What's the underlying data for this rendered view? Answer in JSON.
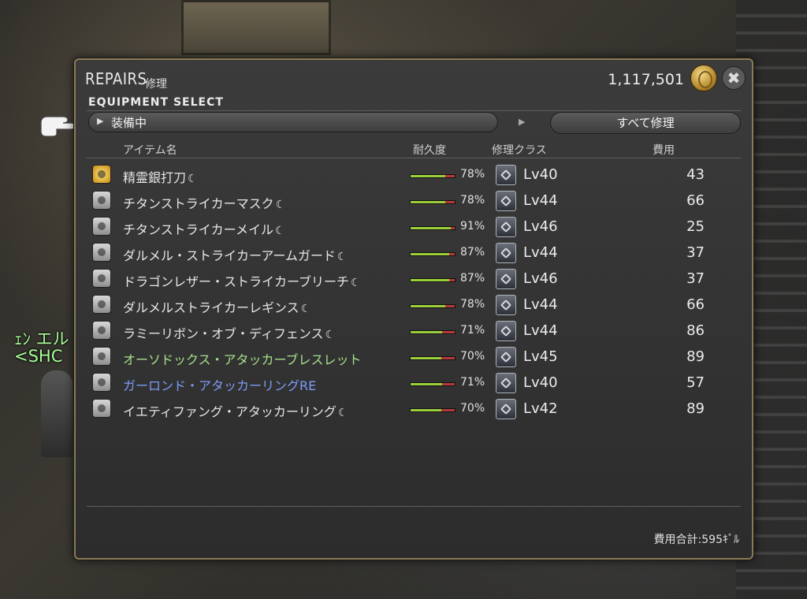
{
  "window": {
    "title": "REPAIRS",
    "title_jp": "修理",
    "gil": "1,117,501",
    "close_glyph": "✖",
    "section": "EQUIPMENT SELECT"
  },
  "controls": {
    "category_value": "装備中",
    "repair_all_label": "すべて修理"
  },
  "headers": {
    "item": "アイテム名",
    "durability": "耐久度",
    "repair_class": "修理クラス",
    "cost": "費用"
  },
  "items": [
    {
      "name": "精霊銀打刀",
      "hq": true,
      "durability": 78,
      "durability_text": "78%",
      "level": "Lv40",
      "cost": "43",
      "color": "white",
      "icon": "sword-icon",
      "icon_style": "gold",
      "class_icon": "blacksmith-icon"
    },
    {
      "name": "チタンストライカーマスク",
      "hq": true,
      "durability": 78,
      "durability_text": "78%",
      "level": "Lv44",
      "cost": "66",
      "color": "white",
      "icon": "mask-icon",
      "class_icon": "armorer-icon"
    },
    {
      "name": "チタンストライカーメイル",
      "hq": true,
      "durability": 91,
      "durability_text": "91%",
      "level": "Lv46",
      "cost": "25",
      "color": "white",
      "icon": "body-armor-icon",
      "class_icon": "armorer-icon"
    },
    {
      "name": "ダルメル・ストライカーアームガード",
      "hq": true,
      "durability": 87,
      "durability_text": "87%",
      "level": "Lv44",
      "cost": "37",
      "color": "white",
      "icon": "gauntlet-icon",
      "class_icon": "leatherworker-icon"
    },
    {
      "name": "ドラゴンレザー・ストライカーブリーチ",
      "hq": true,
      "durability": 87,
      "durability_text": "87%",
      "level": "Lv46",
      "cost": "37",
      "color": "white",
      "icon": "legs-icon",
      "class_icon": "leatherworker-icon"
    },
    {
      "name": "ダルメルストライカーレギンス",
      "hq": true,
      "durability": 78,
      "durability_text": "78%",
      "level": "Lv44",
      "cost": "66",
      "color": "white",
      "icon": "boots-icon",
      "class_icon": "leatherworker-icon"
    },
    {
      "name": "ラミーリボン・オブ・ディフェンス",
      "hq": true,
      "durability": 71,
      "durability_text": "71%",
      "level": "Lv44",
      "cost": "86",
      "color": "white",
      "icon": "belt-icon",
      "class_icon": "weaver-icon"
    },
    {
      "name": "オーソドックス・アタッカーブレスレット",
      "hq": false,
      "durability": 70,
      "durability_text": "70%",
      "level": "Lv45",
      "cost": "89",
      "color": "green",
      "icon": "bracelet-icon",
      "class_icon": "goldsmith-icon"
    },
    {
      "name": "ガーロンド・アタッカーリングRE",
      "hq": false,
      "durability": 71,
      "durability_text": "71%",
      "level": "Lv40",
      "cost": "57",
      "color": "blue",
      "icon": "ring-icon",
      "class_icon": "goldsmith-icon"
    },
    {
      "name": "イエティファング・アタッカーリング",
      "hq": true,
      "durability": 70,
      "durability_text": "70%",
      "level": "Lv42",
      "cost": "89",
      "color": "white",
      "icon": "ring-icon",
      "class_icon": "goldsmith-icon"
    }
  ],
  "hq_glyph": "☾",
  "footer": {
    "total": "費用合計:595ｷﾞﾙ"
  },
  "background": {
    "label1": "ｪﾝ エル",
    "label2": "<SHC"
  },
  "colors": {
    "frame": "#8c7a55",
    "bar_good": "#9ccf3c",
    "bar_bad": "#b33a3a",
    "rare_green": "#a6e08a",
    "rare_blue": "#7e9cf7"
  }
}
